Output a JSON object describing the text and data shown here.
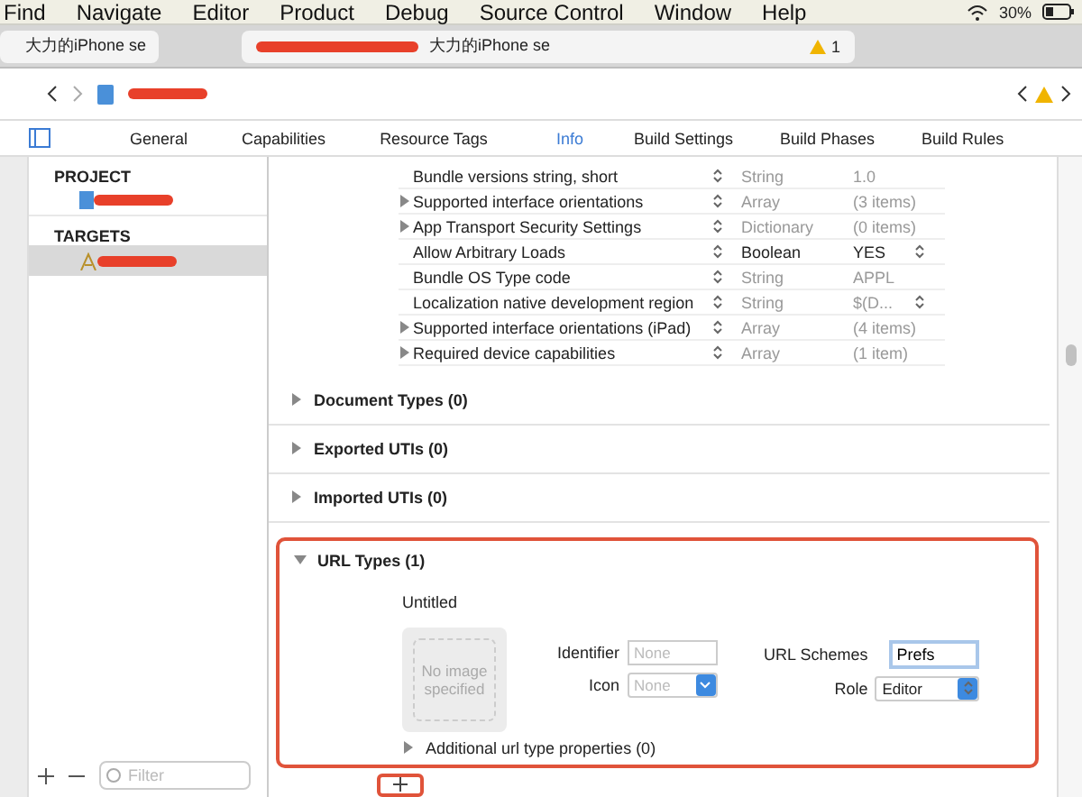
{
  "menu_bar": {
    "items": [
      "Find",
      "Navigate",
      "Editor",
      "Product",
      "Debug",
      "Source Control",
      "Window",
      "Help"
    ],
    "battery": "30%"
  },
  "title_bar": {
    "scheme": "大力的iPhone se",
    "activity": "大力的iPhone se",
    "warnings": "1"
  },
  "editor_tabs": [
    {
      "label": "General",
      "selected": false
    },
    {
      "label": "Capabilities",
      "selected": false
    },
    {
      "label": "Resource Tags",
      "selected": false
    },
    {
      "label": "Info",
      "selected": true
    },
    {
      "label": "Build Settings",
      "selected": false
    },
    {
      "label": "Build Phases",
      "selected": false
    },
    {
      "label": "Build Rules",
      "selected": false
    }
  ],
  "sidebar": {
    "sections": [
      {
        "title": "PROJECT",
        "items": [
          {
            "kind": "project",
            "selected": false
          }
        ]
      },
      {
        "title": "TARGETS",
        "items": [
          {
            "kind": "target",
            "selected": true
          }
        ]
      }
    ],
    "filter_placeholder": "Filter"
  },
  "plist_rows": [
    {
      "key": "Bundle versions string, short",
      "expandable": false,
      "type": "String",
      "type_dimmed": true,
      "value": "1.0",
      "value_popup": false
    },
    {
      "key": "Supported interface orientations",
      "expandable": true,
      "type": "Array",
      "type_dimmed": true,
      "value": "(3 items)",
      "value_popup": false
    },
    {
      "key": "App Transport Security Settings",
      "expandable": true,
      "type": "Dictionary",
      "type_dimmed": true,
      "value": "(0 items)",
      "value_popup": false
    },
    {
      "key": "Allow Arbitrary Loads",
      "expandable": false,
      "type": "Boolean",
      "type_dimmed": false,
      "value": "YES",
      "value_popup": true
    },
    {
      "key": "Bundle OS Type code",
      "expandable": false,
      "type": "String",
      "type_dimmed": true,
      "value": "APPL",
      "value_popup": false
    },
    {
      "key": "Localization native development region",
      "expandable": false,
      "type": "String",
      "type_dimmed": true,
      "value": "$(D...",
      "value_popup": true
    },
    {
      "key": "Supported interface orientations (iPad)",
      "expandable": true,
      "type": "Array",
      "type_dimmed": true,
      "value": "(4 items)",
      "value_popup": false
    },
    {
      "key": "Required device capabilities",
      "expandable": true,
      "type": "Array",
      "type_dimmed": true,
      "value": "(1 item)",
      "value_popup": false
    }
  ],
  "sections": [
    {
      "title": "Document Types (0)",
      "expanded": false
    },
    {
      "title": "Exported UTIs (0)",
      "expanded": false
    },
    {
      "title": "Imported UTIs (0)",
      "expanded": false
    },
    {
      "title": "URL Types (1)",
      "expanded": true
    }
  ],
  "url_type": {
    "name": "Untitled",
    "image_placeholder": "No image specified",
    "identifier_label": "Identifier",
    "identifier_placeholder": "None",
    "icon_label": "Icon",
    "icon_placeholder": "None",
    "schemes_label": "URL Schemes",
    "schemes_value": "Prefs",
    "role_label": "Role",
    "role_value": "Editor",
    "additional": "Additional url type properties (0)"
  }
}
